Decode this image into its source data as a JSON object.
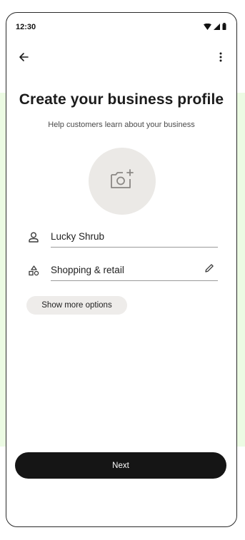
{
  "status_bar": {
    "time": "12:30",
    "icons": [
      "wifi-icon",
      "signal-icon",
      "battery-icon"
    ]
  },
  "app_bar": {
    "back_icon": "arrow-left-icon",
    "menu_icon": "more-vertical-icon"
  },
  "header": {
    "title": "Create your business profile",
    "subtitle": "Help customers learn about your business"
  },
  "photo": {
    "icon": "add-photo-icon"
  },
  "form": {
    "business_name": {
      "icon": "person-icon",
      "value": "Lucky Shrub"
    },
    "category": {
      "icon": "category-shapes-icon",
      "value": "Shopping & retail",
      "edit_icon": "pencil-icon"
    }
  },
  "actions": {
    "more_options_label": "Show more options",
    "next_label": "Next"
  },
  "colors": {
    "background_band": "#ecfbe3",
    "primary_button": "#151515",
    "photo_placeholder": "#ebe9e6",
    "chip": "#eeecea"
  }
}
